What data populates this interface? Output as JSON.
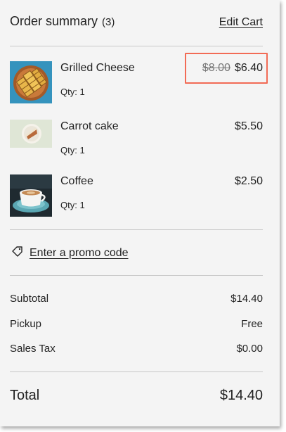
{
  "header": {
    "title": "Order summary",
    "count": "(3)",
    "edit_cart": "Edit Cart"
  },
  "items": [
    {
      "name": "Grilled Cheese",
      "qty": "Qty: 1",
      "old_price": "$8.00",
      "price": "$6.40",
      "thumb": "grilled-cheese-image"
    },
    {
      "name": "Carrot cake",
      "qty": "Qty: 1",
      "price": "$5.50",
      "thumb": "carrot-cake-image"
    },
    {
      "name": "Coffee",
      "qty": "Qty: 1",
      "price": "$2.50",
      "thumb": "coffee-image"
    }
  ],
  "promo": {
    "label": "Enter a promo code",
    "icon": "tag-icon"
  },
  "summary": {
    "subtotal_label": "Subtotal",
    "subtotal_value": "$14.40",
    "pickup_label": "Pickup",
    "pickup_value": "Free",
    "tax_label": "Sales Tax",
    "tax_value": "$0.00",
    "total_label": "Total",
    "total_value": "$14.40"
  },
  "colors": {
    "highlight": "#f26b55",
    "panel": "#f4f4f4"
  }
}
